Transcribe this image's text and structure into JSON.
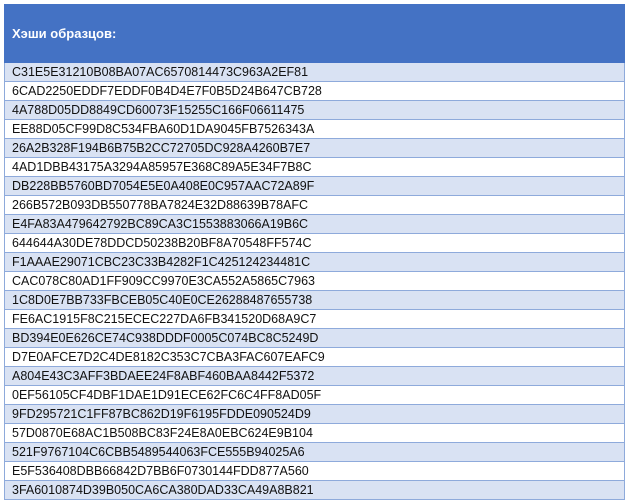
{
  "table": {
    "header": "Хэши образцов:",
    "rows": [
      "C31E5E31210B08BA07AC6570814473C963A2EF81",
      "6CAD2250EDDF7EDDF0B4D4E7F0B5D24B647CB728",
      "4A788D05DD8849CD60073F15255C166F06611475",
      "EE88D05CF99D8C534FBA60D1DA9045FB7526343A",
      "26A2B328F194B6B75B2CC72705DC928A4260B7E7",
      "4AD1DBB43175A3294A85957E368C89A5E34F7B8C",
      "DB228BB5760BD7054E5E0A408E0C957AAC72A89F",
      "266B572B093DB550778BA7824E32D88639B78AFC",
      "E4FA83A479642792BC89CA3C1553883066A19B6C",
      "644644A30DE78DDCD50238B20BF8A70548FF574C",
      "F1AAAE29071CBC23C33B4282F1C425124234481C",
      "CAC078C80AD1FF909CC9970E3CA552A5865C7963",
      "1C8D0E7BB733FBCEB05C40E0CE26288487655738",
      "FE6AC1915F8C215ECEC227DA6FB341520D68A9C7",
      "BD394E0E626CE74C938DDDF0005C074BC8C5249D",
      "D7E0AFCE7D2C4DE8182C353C7CBA3FAC607EAFC9",
      "A804E43C3AFF3BDAEE24F8ABF460BAA8442F5372",
      "0EF56105CF4DBF1DAE1D91ECE62FC6C4FF8AD05F",
      "9FD295721C1FF87BC862D19F6195FDDE090524D9",
      "57D0870E68AC1B508BC83F24E8A0EBC624E9B104",
      "521F9767104C6CBB5489544063FCE555B94025A6",
      "E5F536408DBB66842D7BB6F0730144FDD877A560",
      "3FA6010874D39B050CA6CA380DAD33CA49A8B821"
    ]
  }
}
